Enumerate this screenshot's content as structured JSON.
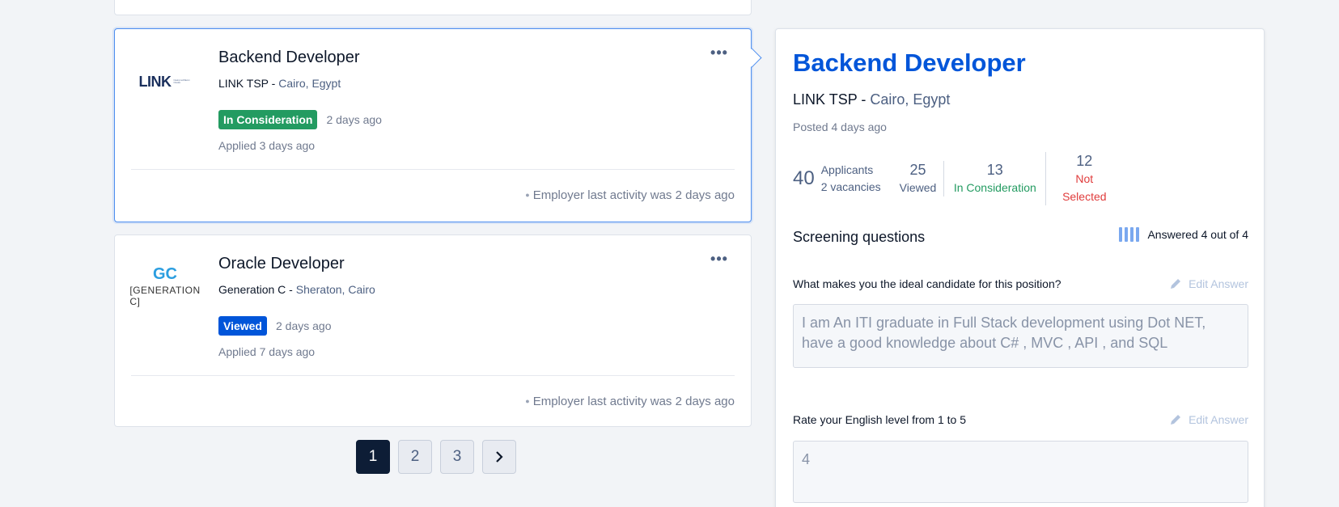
{
  "jobs": [
    {
      "title": "Backend Developer",
      "company": "LINK TSP",
      "location": "Cairo, Egypt",
      "logo_text": "LINK",
      "logo_subtext": "Development Telecom Providers",
      "status": "In Consideration",
      "status_color": "#239b61",
      "status_time": "2 days ago",
      "applied": "Applied 3 days ago",
      "activity": "Employer last activity was 2 days ago",
      "more_icon": "more-horizontal-icon"
    },
    {
      "title": "Oracle Developer",
      "company": "Generation C",
      "location": "Sheraton, Cairo",
      "logo_mark": "GC",
      "logo_text": "[GENERATION C]",
      "status": "Viewed",
      "status_color": "#0055d9",
      "status_time": "2 days ago",
      "applied": "Applied 7 days ago",
      "activity": "Employer last activity was 2 days ago",
      "more_icon": "more-horizontal-icon"
    }
  ],
  "separator": " - ",
  "pagination": {
    "pages": [
      "1",
      "2",
      "3"
    ],
    "current": "1",
    "next_icon": "chevron-right-icon"
  },
  "detail": {
    "title": "Backend Developer",
    "company": "LINK TSP",
    "location": "Cairo, Egypt",
    "posted": "Posted 4 days ago",
    "stats": {
      "applicants_count": "40",
      "applicants_label": "Applicants",
      "vacancies": "2 vacancies",
      "viewed_count": "25",
      "viewed_label": "Viewed",
      "consideration_count": "13",
      "consideration_label": "In Consideration",
      "not_selected_count": "12",
      "not_selected_label": "Not Selected"
    },
    "screening": {
      "title": "Screening questions",
      "answered": "Answered 4 out of 4",
      "progress": 1.0,
      "edit_label": "Edit Answer",
      "questions": [
        {
          "question": "What makes you the ideal candidate for this position?",
          "answer": "I am An ITI graduate in Full Stack development using Dot NET, have a good knowledge about C# , MVC , API , and SQL"
        },
        {
          "question": "Rate your English level from 1 to 5",
          "answer": "4"
        }
      ]
    }
  },
  "colors": {
    "accent": "#0055d9",
    "success": "#239b61",
    "danger": "#e03c3c",
    "page_active": "#0d1d36"
  }
}
